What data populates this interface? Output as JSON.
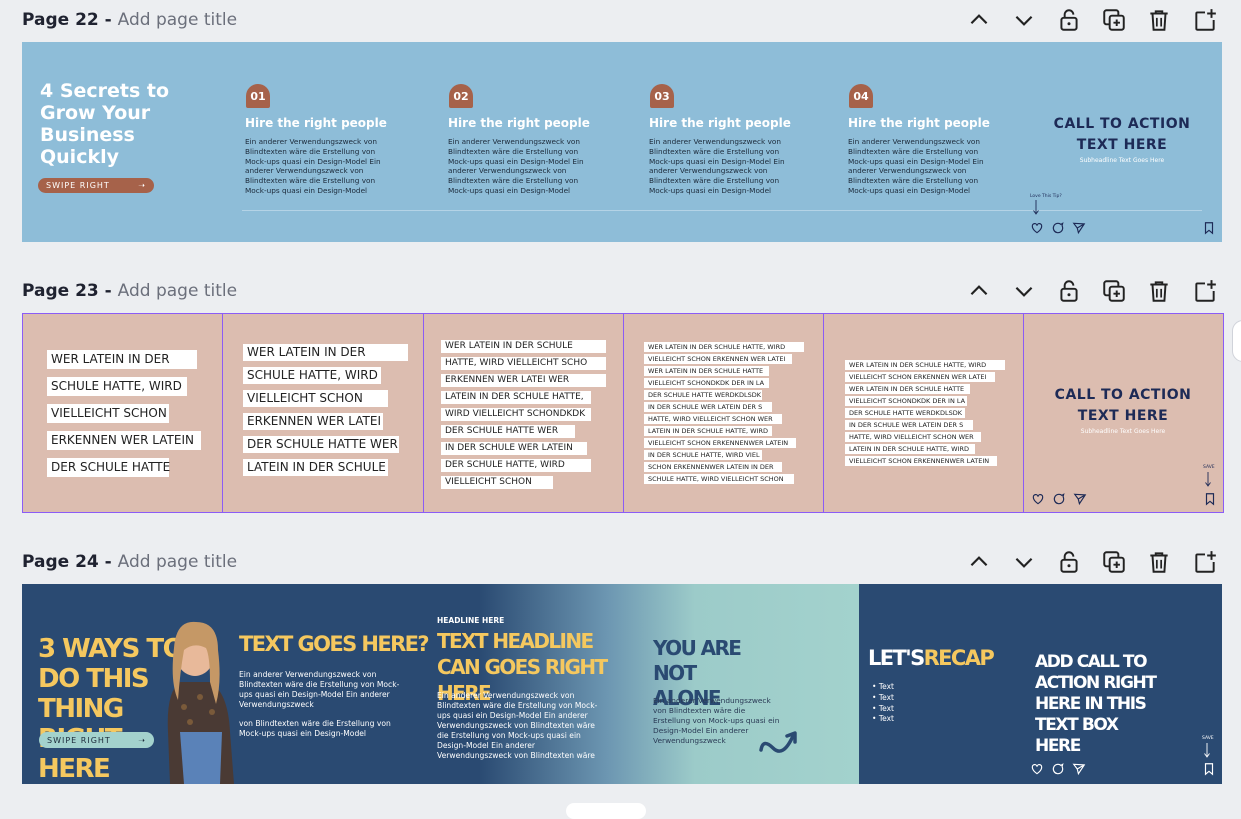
{
  "pages": [
    {
      "number": "Page 22",
      "separator": "-",
      "title_placeholder": "Add page title"
    },
    {
      "number": "Page 23",
      "separator": "-",
      "title_placeholder": "Add page title"
    },
    {
      "number": "Page 24",
      "separator": "-",
      "title_placeholder": "Add page title"
    }
  ],
  "toolbar_icons": [
    "chevron-up-icon",
    "chevron-down-icon",
    "lock-icon",
    "duplicate-icon",
    "trash-icon",
    "add-page-icon"
  ],
  "colors": {
    "page22_bg": "#8ebdd8",
    "page23_bg": "#dcbdb0",
    "page24_bg": "#2a4a72",
    "accent_brown": "#a6624a",
    "cta_navy": "#1d2a56",
    "yellow": "#f5c85f",
    "selection": "#8b5cf6"
  },
  "p22": {
    "title": "4 Secrets to Grow Your Business Quickly",
    "swipe_label": "SWIPE RIGHT",
    "steps": [
      {
        "num": "01",
        "title": "Hire the right people",
        "body": "Ein anderer Verwendungszweck von Blindtexten wäre die Erstellung von Mock-ups quasi ein Design-Model Ein anderer Verwendungszweck von Blindtexten wäre die Erstellung von Mock-ups quasi ein Design-Model"
      },
      {
        "num": "02",
        "title": "Hire the right people",
        "body": "Ein anderer Verwendungszweck von Blindtexten wäre die Erstellung von Mock-ups quasi ein Design-Model Ein anderer Verwendungszweck von Blindtexten wäre die Erstellung von Mock-ups quasi ein Design-Model"
      },
      {
        "num": "03",
        "title": "Hire the right people",
        "body": "Ein anderer Verwendungszweck von Blindtexten wäre die Erstellung von Mock-ups quasi ein Design-Model Ein anderer Verwendungszweck von Blindtexten wäre die Erstellung von Mock-ups quasi ein Design-Model"
      },
      {
        "num": "04",
        "title": "Hire the right people",
        "body": "Ein anderer Verwendungszweck von Blindtexten wäre die Erstellung von Mock-ups quasi ein Design-Model Ein anderer Verwendungszweck von Blindtexten wäre die Erstellung von Mock-ups quasi ein Design-Model"
      }
    ],
    "cta_line1": "CALL TO ACTION",
    "cta_line2": "TEXT HERE",
    "cta_sub": "Subheadline Text Goes Here",
    "love_tip": "Love This Tip?"
  },
  "p23": {
    "col1": [
      "WER LATEIN IN DER",
      "SCHULE HATTE, WIRD",
      "VIELLEICHT SCHON",
      "ERKENNEN WER LATEIN",
      "DER SCHULE HATTE"
    ],
    "col2": [
      "WER LATEIN IN DER",
      "SCHULE HATTE, WIRD",
      "VIELLEICHT SCHON",
      "ERKENNEN WER LATEI",
      "DER SCHULE HATTE WER",
      "LATEIN IN DER SCHULE"
    ],
    "col3": [
      "WER LATEIN IN DER SCHULE",
      "HATTE, WIRD VIELLEICHT SCHO",
      "ERKENNEN WER LATEI WER",
      "LATEIN IN DER SCHULE HATTE,",
      "WIRD VIELLEICHT SCHONDKDK",
      "DER SCHULE HATTE WER",
      " IN DER SCHULE WER LATEIN",
      "DER SCHULE HATTE, WIRD",
      "VIELLEICHT SCHON"
    ],
    "col4": [
      "WER LATEIN IN DER SCHULE HATTE, WIRD",
      "VIELLEICHT SCHON ERKENNEN WER LATEI",
      "WER LATEIN IN DER SCHULE HATTE",
      "VIELLEICHT SCHONDKDK DER IN LA",
      "DER SCHULE HATTE WERDKDLSDK",
      " IN DER SCHULE WER LATEIN  DER S",
      "HATTE, WIRD VIELLEICHT SCHON WER",
      "LATEIN IN DER SCHULE HATTE, WIRD",
      "VIELLEICHT SCHON ERKENNENWER LATEIN",
      "IN DER SCHULE HATTE, WIRD VIEL",
      " SCHON ERKENNENWER LATEIN IN DER",
      "SCHULE HATTE, WIRD VIELLEICHT SCHON"
    ],
    "col5": [
      "WER LATEIN IN DER SCHULE HATTE, WIRD",
      "VIELLEICHT SCHON ERKENNEN WER LATEI",
      "WER LATEIN IN DER SCHULE HATTE",
      "VIELLEICHT SCHONDKDK DER IN LA",
      "DER SCHULE HATTE WERDKDLSDK",
      " IN DER SCHULE WER LATEIN  DER S",
      " HATTE, WIRD VIELLEICHT SCHON WER",
      "LATEIN IN DER SCHULE HATTE, WIRD",
      "VIELLEICHT SCHON ERKENNENWER LATEIN"
    ],
    "cta_line1": "CALL TO ACTION",
    "cta_line2": "TEXT HERE",
    "cta_sub": "Subheadline Text Goes Here",
    "save_label": "SAVE"
  },
  "p24": {
    "title": "3 WAYS TO DO THIS THING RIGHT HERE",
    "swipe_label": "SWIPE RIGHT",
    "s2_headline": "TEXT GOES HERE?",
    "s2_body1": "Ein anderer Verwendungszweck von Blindtexten wäre die Erstellung von Mock-ups quasi ein Design-Model Ein anderer Verwendungszweck",
    "s2_body2": "von Blindtexten wäre die Erstellung von Mock-ups quasi ein Design-Model",
    "s3_kicker": "HEADLINE HERE",
    "s3_headline": "TEXT HEADLINE CAN GOES RIGHT HERE",
    "s3_body": "Ein anderer Verwendungszweck von Blindtexten wäre die Erstellung von Mock-ups quasi ein Design-Model Ein anderer Verwendungszweck von Blindtexten wäre die Erstellung von Mock-ups quasi ein Design-Model Ein anderer Verwendungszweck von Blindtexten wäre",
    "s4_headline": "YOU ARE NOT ALONE",
    "s4_body": "Ein anderer Verwendungszweck von Blindtexten wäre die Erstellung von Mock-ups quasi ein Design-Model Ein anderer Verwendungszweck",
    "s5_lets": "LET'S",
    "s5_recap": "RECAP",
    "s5_bullets": [
      "Text",
      "Text",
      "Text",
      "Text"
    ],
    "s6_headline": "ADD CALL TO ACTION RIGHT HERE IN THIS TEXT BOX HERE",
    "save_label": "SAVE"
  }
}
